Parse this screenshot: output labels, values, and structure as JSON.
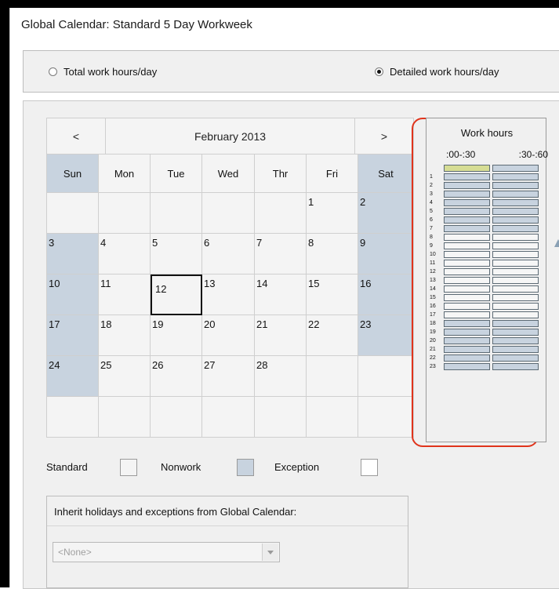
{
  "window": {
    "title": "Global Calendar: Standard 5 Day Workweek"
  },
  "mode": {
    "total_label": "Total work hours/day",
    "detailed_label": "Detailed work hours/day",
    "selected": "detailed"
  },
  "calendar": {
    "prev_label": "<",
    "next_label": ">",
    "month_label": "February 2013",
    "days_of_week": [
      "Sun",
      "Mon",
      "Tue",
      "Wed",
      "Thr",
      "Fri",
      "Sat"
    ],
    "weeks": [
      [
        "",
        "",
        "",
        "",
        "",
        "1",
        "2"
      ],
      [
        "3",
        "4",
        "5",
        "6",
        "7",
        "8",
        "9"
      ],
      [
        "10",
        "11",
        "12",
        "13",
        "14",
        "15",
        "16"
      ],
      [
        "17",
        "18",
        "19",
        "20",
        "21",
        "22",
        "23"
      ],
      [
        "24",
        "25",
        "26",
        "27",
        "28",
        "",
        ""
      ],
      [
        "",
        "",
        "",
        "",
        "",
        "",
        ""
      ]
    ],
    "selected_day": "12"
  },
  "work_hours": {
    "title": "Work hours",
    "col1_label": ":00-:30",
    "col2_label": ":30-:60",
    "hours": [
      "",
      "1",
      "2",
      "3",
      "4",
      "5",
      "6",
      "7",
      "8",
      "9",
      "10",
      "11",
      "12",
      "13",
      "14",
      "15",
      "16",
      "17",
      "18",
      "19",
      "20",
      "21",
      "22",
      "23"
    ],
    "work_slots_hours": [
      "8",
      "9",
      "10",
      "11",
      "12",
      "13",
      "14",
      "15",
      "16",
      "17"
    ],
    "selected_slot": "0-first"
  },
  "legend": {
    "standard": "Standard",
    "nonwork": "Nonwork",
    "exception": "Exception"
  },
  "inherit": {
    "label": "Inherit holidays and exceptions from Global Calendar:",
    "dropdown_value": "<None>"
  },
  "colors": {
    "nonwork": "#c8d3df",
    "highlight_ring": "#e0341c",
    "selected_slot": "#d6dd94"
  }
}
